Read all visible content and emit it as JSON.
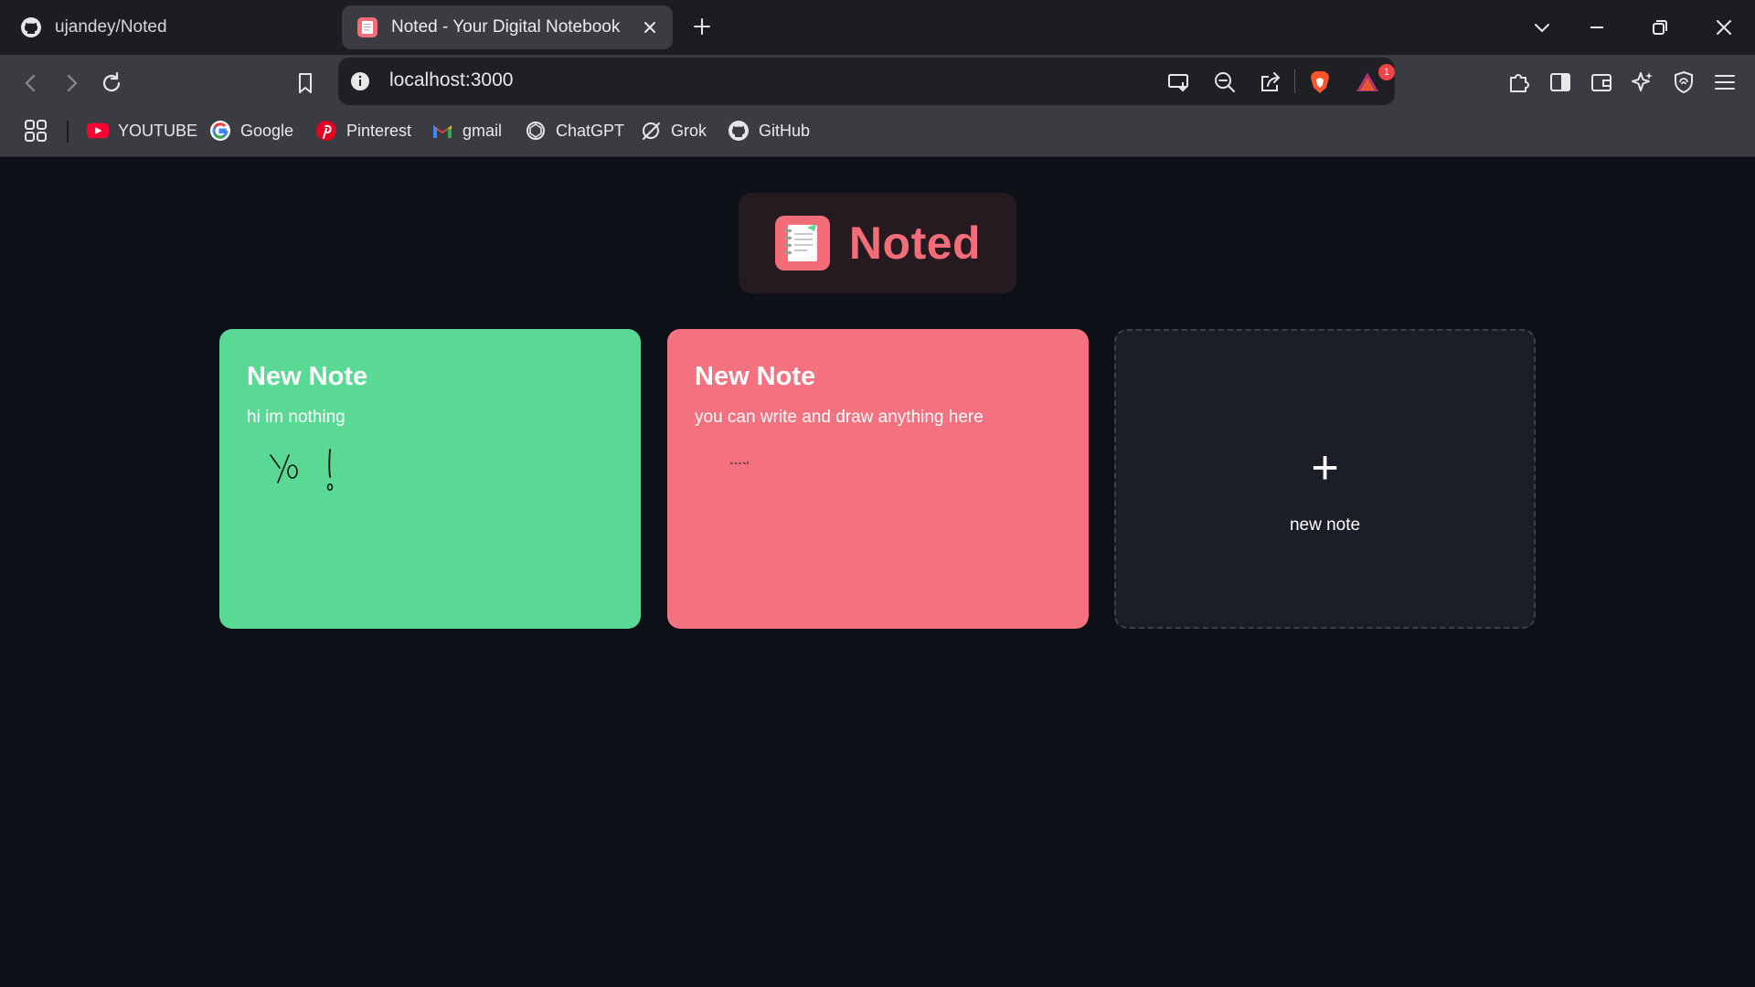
{
  "browser": {
    "tabs": [
      {
        "title": "ujandey/Noted",
        "active": false,
        "icon": "github-icon"
      },
      {
        "title": "Noted - Your Digital Notebook",
        "active": true,
        "icon": "notebook-icon"
      }
    ],
    "address": "localhost:3000",
    "notification_count": "1",
    "bookmarks": [
      {
        "label": "YOUTUBE",
        "icon": "youtube-icon"
      },
      {
        "label": "Google",
        "icon": "google-icon"
      },
      {
        "label": "Pinterest",
        "icon": "pinterest-icon"
      },
      {
        "label": "gmail",
        "icon": "gmail-icon"
      },
      {
        "label": "ChatGPT",
        "icon": "chatgpt-icon"
      },
      {
        "label": "Grok",
        "icon": "grok-icon"
      },
      {
        "label": "GitHub",
        "icon": "github-icon"
      }
    ]
  },
  "app": {
    "name": "Noted",
    "accent_color": "#f26d78",
    "notes": [
      {
        "title": "New Note",
        "body": "hi im nothing",
        "color": "#5ad995",
        "drawing": "Yo !"
      },
      {
        "title": "New Note",
        "body": "you can write and draw anything here",
        "color": "#f4727f",
        "drawing": "Be Free!"
      }
    ],
    "new_note": {
      "icon": "+",
      "label": "new note"
    }
  }
}
